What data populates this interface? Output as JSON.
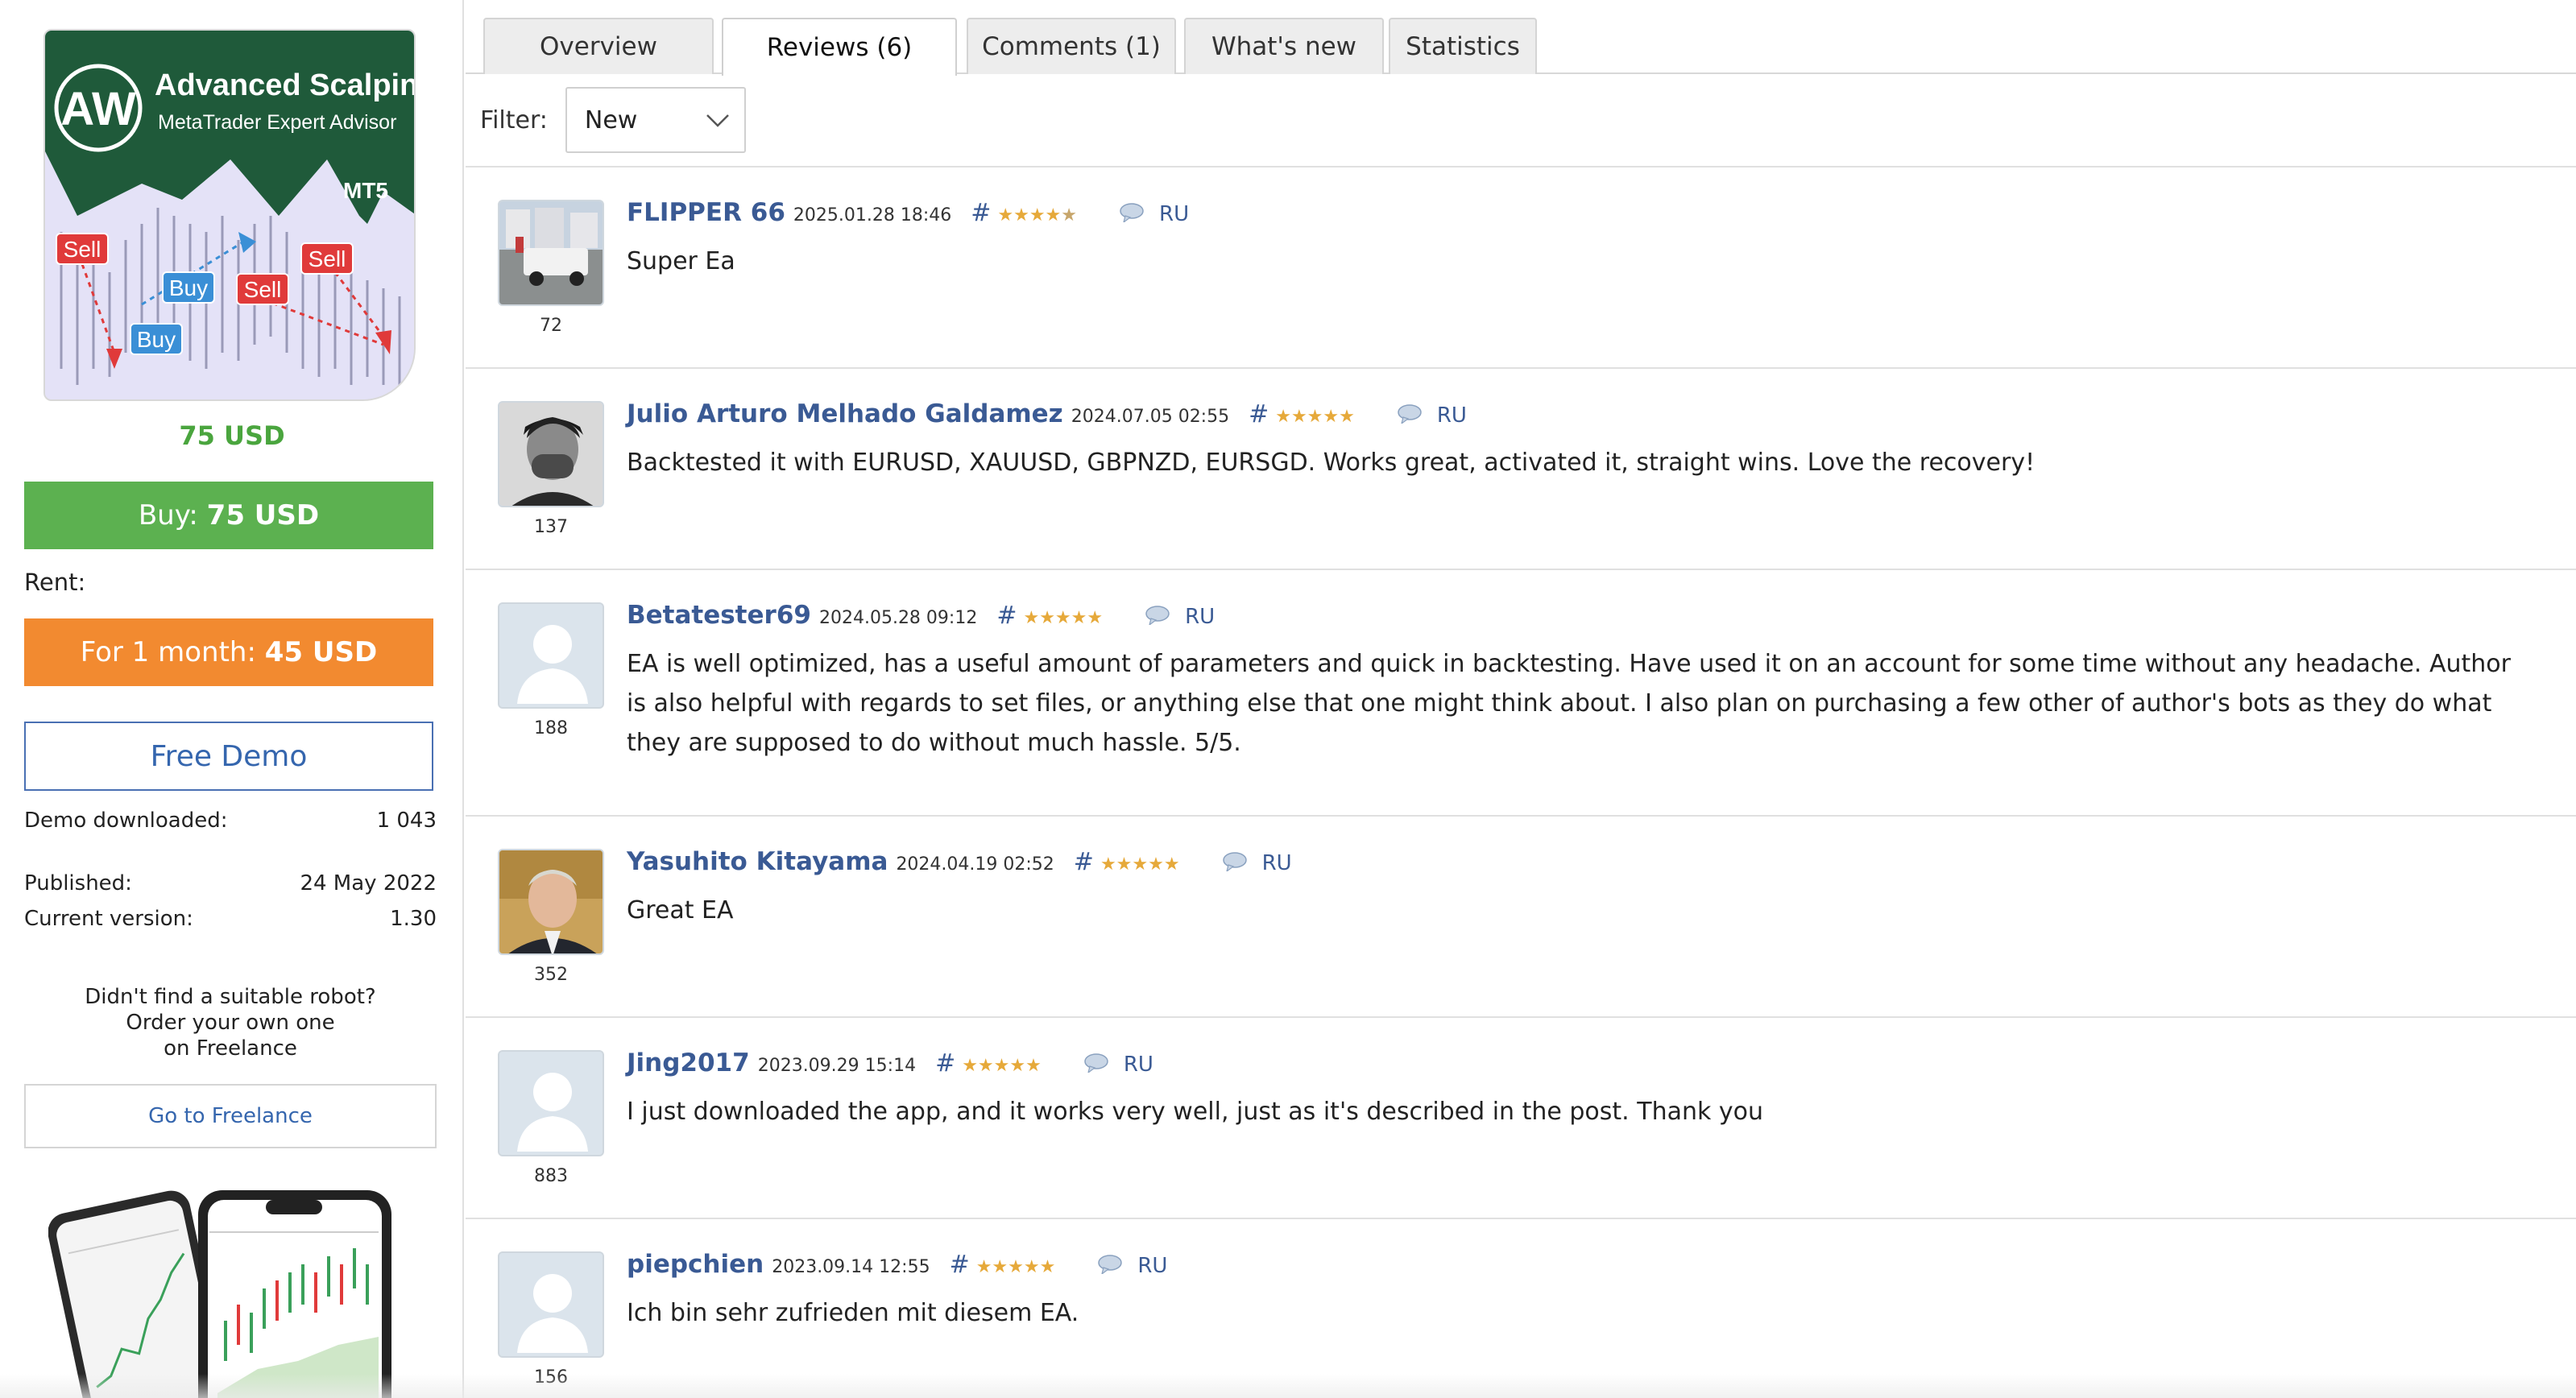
{
  "product": {
    "image_title": "Advanced Scalping EA",
    "image_subtitle": "MetaTrader Expert Advisor",
    "image_logo": "AW",
    "image_platform": "MT5",
    "image_labels": {
      "sell": "Sell",
      "buy": "Buy"
    },
    "price": "75 USD"
  },
  "buy_button": {
    "label": "Buy:",
    "amount": "75 USD"
  },
  "rent": {
    "label": "Rent:",
    "button_label": "For 1 month:",
    "button_amount": "45 USD"
  },
  "demo_button": {
    "label": "Free Demo"
  },
  "stats": {
    "demo_downloaded_label": "Demo downloaded:",
    "demo_downloaded_value": "1 043",
    "published_label": "Published:",
    "published_value": "24 May 2022",
    "version_label": "Current version:",
    "version_value": "1.30"
  },
  "freelance": {
    "line1": "Didn't find a suitable robot?",
    "line2": "Order your own one",
    "line3": "on Freelance",
    "button_label": "Go to Freelance"
  },
  "tabs": [
    {
      "label": "Overview",
      "active": false
    },
    {
      "label": "Reviews (6)",
      "active": true
    },
    {
      "label": "Comments (1)",
      "active": false
    },
    {
      "label": "What's new",
      "active": false
    },
    {
      "label": "Statistics",
      "active": false
    }
  ],
  "filter": {
    "label": "Filter:",
    "value": "New"
  },
  "reviews": [
    {
      "name": "FLIPPER 66",
      "date": "2025.01.28 18:46",
      "rating": 4.5,
      "hash": "#",
      "lang": "RU",
      "author_rating": "72",
      "text": "Super Ea",
      "avatar": "truck-photo"
    },
    {
      "name": "Julio Arturo Melhado Galdamez",
      "date": "2024.07.05 02:55",
      "rating": 5,
      "hash": "#",
      "lang": "RU",
      "author_rating": "137",
      "text": "Backtested it with EURUSD, XAUUSD, GBPNZD, EURSGD. Works great, activated it, straight wins. Love the recovery!",
      "avatar": "portrait-photo"
    },
    {
      "name": "Betatester69",
      "date": "2024.05.28 09:12",
      "rating": 5,
      "hash": "#",
      "lang": "RU",
      "author_rating": "188",
      "text": "EA is well optimized, has a useful amount of parameters and quick in backtesting. Have used it on an account for some time without any headache. Author is also helpful with regards to set files, or anything else that one might think about. I also plan on purchasing a few other of author's bots as they do what they are supposed to do without much hassle. 5/5.",
      "avatar": "default"
    },
    {
      "name": "Yasuhito Kitayama",
      "date": "2024.04.19 02:52",
      "rating": 5,
      "hash": "#",
      "lang": "RU",
      "author_rating": "352",
      "text": "Great EA",
      "avatar": "painting-portrait"
    },
    {
      "name": "Jing2017",
      "date": "2023.09.29 15:14",
      "rating": 5,
      "hash": "#",
      "lang": "RU",
      "author_rating": "883",
      "text": "I just downloaded the app, and it works very well, just as it's described in the post. Thank you",
      "avatar": "default"
    },
    {
      "name": "piepchien",
      "date": "2023.09.14 12:55",
      "rating": 5,
      "hash": "#",
      "lang": "RU",
      "author_rating": "156",
      "text": "Ich bin sehr zufrieden mit diesem EA.",
      "avatar": "default"
    }
  ],
  "colors": {
    "price_green": "#4aa53e",
    "buy_green": "#5cb150",
    "rent_orange": "#f28a30",
    "link_blue": "#3a5a94",
    "star_gold": "#e6a93a"
  },
  "icons": {
    "comment": "speech-bubble-icon",
    "dropdown": "chevron-down-icon",
    "avatar_default": "default-user-icon"
  }
}
